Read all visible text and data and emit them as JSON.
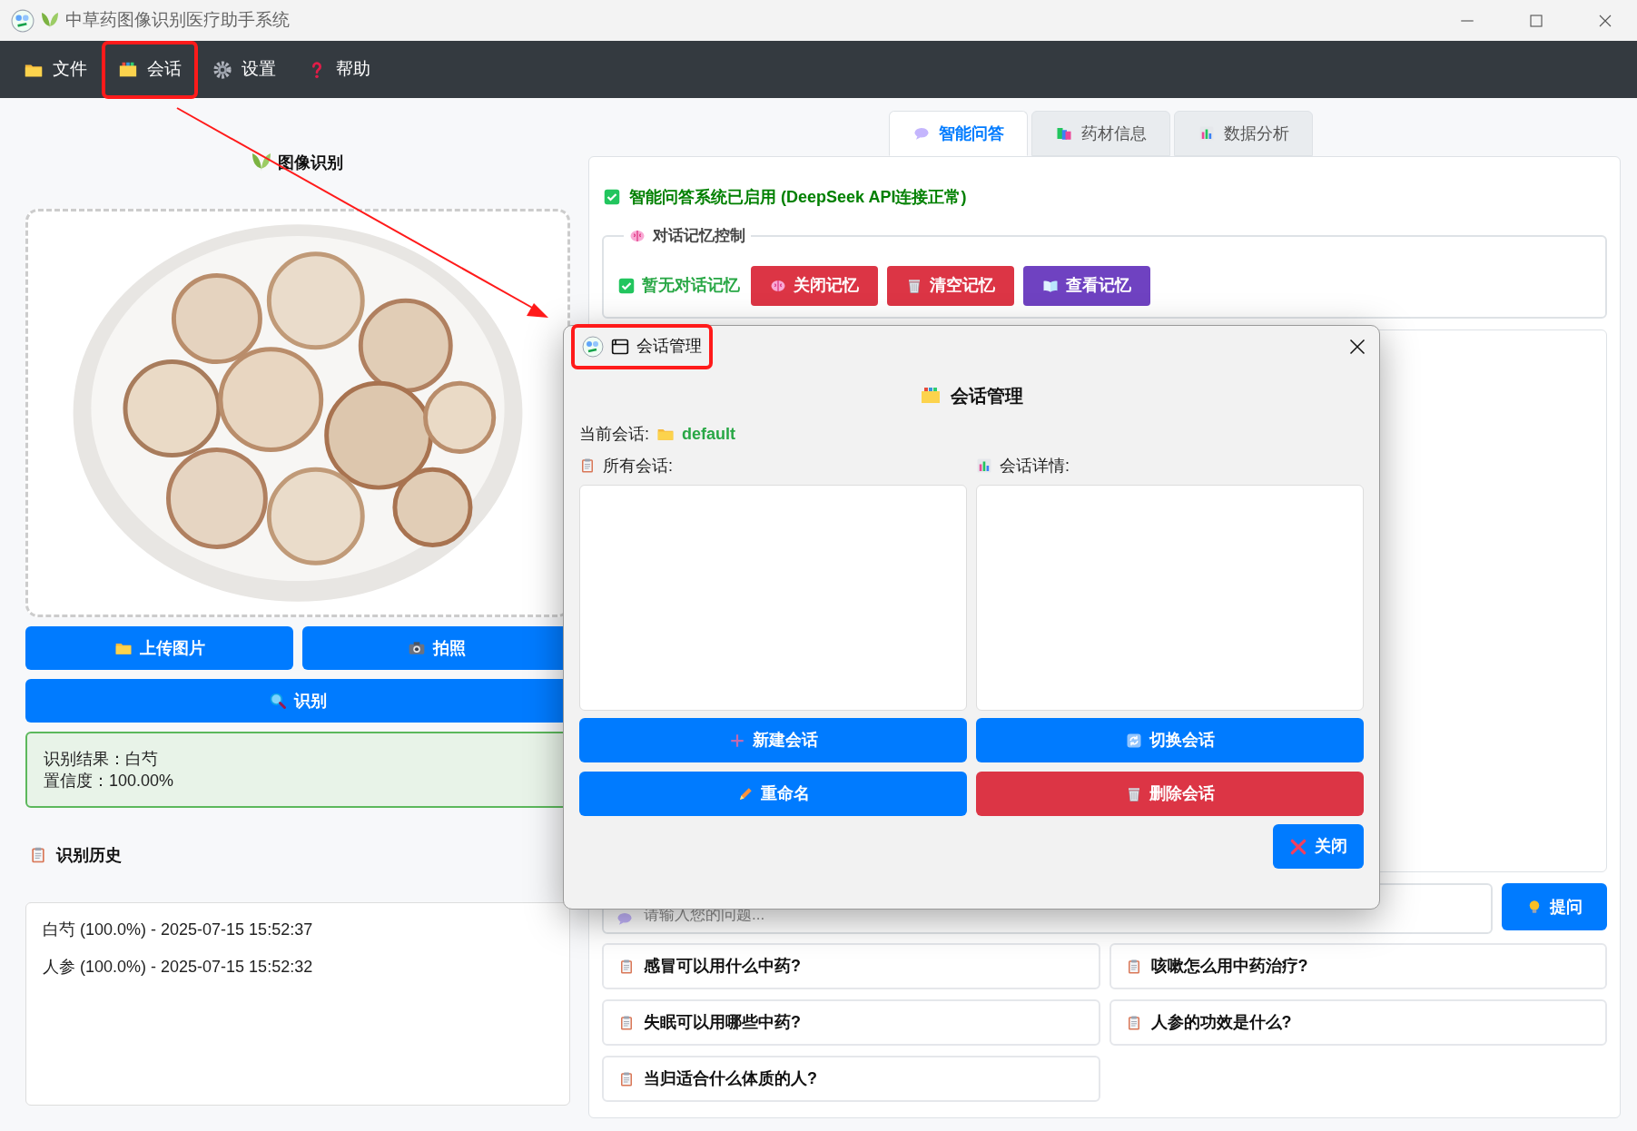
{
  "window": {
    "title": "中草药图像识别医疗助手系统"
  },
  "menu": [
    {
      "label": "文件",
      "annotated": false
    },
    {
      "label": "会话",
      "annotated": true
    },
    {
      "label": "设置",
      "annotated": false
    },
    {
      "label": "帮助",
      "annotated": false
    }
  ],
  "left": {
    "title": "图像识别",
    "image": {
      "kind": "picture"
    },
    "buttons": [
      {
        "label": "上传图片"
      },
      {
        "label": "拍照"
      }
    ],
    "recognize_button": {
      "label": "识别"
    },
    "result": [
      "识别结果：白芍",
      "置信度：100.00%"
    ],
    "history": {
      "title": "识别历史",
      "items": [
        "白芍 (100.0%) - 2025-07-15 15:52:37",
        "人参 (100.0%) - 2025-07-15 15:52:32"
      ]
    }
  },
  "right": {
    "tabs": [
      {
        "label": "智能问答",
        "selected": true
      },
      {
        "label": "药材信息",
        "selected": false
      },
      {
        "label": "数据分析",
        "selected": false
      }
    ],
    "status": {
      "text": "智能问答系统已启用 (DeepSeek API连接正常)",
      "checked": true
    },
    "memory": {
      "title": "对话记忆控制",
      "status": {
        "text": "暂无对话记忆",
        "checked": true
      },
      "buttons": [
        {
          "label": "关闭记忆",
          "kind": "danger"
        },
        {
          "label": "清空记忆",
          "kind": "danger"
        },
        {
          "label": "查看记忆",
          "kind": "purple"
        }
      ]
    },
    "input": {
      "placeholder": "请输入您的问题...",
      "button": "提问"
    },
    "quick_questions": [
      "感冒可以用什么中药?",
      "咳嗽怎么用中药治疗?",
      "失眠可以用哪些中药?",
      "人参的功效是什么?",
      "当归适合什么体质的人?"
    ]
  },
  "dialog": {
    "title": "会话管理",
    "title_annotated": true,
    "heading": "会话管理",
    "current_label": "当前会话:",
    "current_value": "default",
    "list_label": "所有会话:",
    "details_label": "会话详情:",
    "buttons": [
      {
        "label": "新建会话",
        "kind": "primary"
      },
      {
        "label": "切换会话",
        "kind": "primary"
      },
      {
        "label": "重命名",
        "kind": "primary"
      },
      {
        "label": "删除会话",
        "kind": "danger"
      }
    ],
    "close_button": "关闭"
  }
}
